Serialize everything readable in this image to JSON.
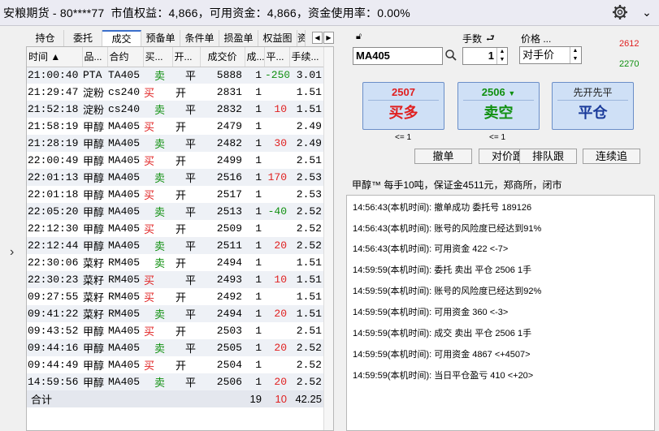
{
  "titlebar": {
    "text": "安粮期货 - 80****77  市值权益：4,866，可用资金：4,866，资金使用率：0.00%"
  },
  "tabs": [
    "持仓",
    "委托",
    "成交",
    "预备单",
    "条件单",
    "损盈单",
    "权益图",
    "资"
  ],
  "active_tab": "成交",
  "trades_table": {
    "columns": [
      "时间 ▲",
      "品...",
      "合约",
      "买...",
      "开...",
      "成交价",
      "成...",
      "平...",
      "手续..."
    ],
    "rows": [
      {
        "time": "21:00:40",
        "product": "PTA",
        "contract": "TA405",
        "dir": "卖",
        "oc": "平",
        "price": "5888",
        "qty": "1",
        "pnl": "-250",
        "fee": "3.01"
      },
      {
        "time": "21:29:47",
        "product": "淀粉",
        "contract": "cs240",
        "dir": "买",
        "oc": "开",
        "price": "2831",
        "qty": "1",
        "pnl": "",
        "fee": "1.51"
      },
      {
        "time": "21:52:18",
        "product": "淀粉",
        "contract": "cs240",
        "dir": "卖",
        "oc": "平",
        "price": "2832",
        "qty": "1",
        "pnl": "10",
        "fee": "1.51"
      },
      {
        "time": "21:58:19",
        "product": "甲醇",
        "contract": "MA405",
        "dir": "买",
        "oc": "开",
        "price": "2479",
        "qty": "1",
        "pnl": "",
        "fee": "2.49"
      },
      {
        "time": "21:28:19",
        "product": "甲醇",
        "contract": "MA405",
        "dir": "卖",
        "oc": "平",
        "price": "2482",
        "qty": "1",
        "pnl": "30",
        "fee": "2.49"
      },
      {
        "time": "22:00:49",
        "product": "甲醇",
        "contract": "MA405",
        "dir": "买",
        "oc": "开",
        "price": "2499",
        "qty": "1",
        "pnl": "",
        "fee": "2.51"
      },
      {
        "time": "22:01:13",
        "product": "甲醇",
        "contract": "MA405",
        "dir": "卖",
        "oc": "平",
        "price": "2516",
        "qty": "1",
        "pnl": "170",
        "fee": "2.53"
      },
      {
        "time": "22:01:18",
        "product": "甲醇",
        "contract": "MA405",
        "dir": "买",
        "oc": "开",
        "price": "2517",
        "qty": "1",
        "pnl": "",
        "fee": "2.53"
      },
      {
        "time": "22:05:20",
        "product": "甲醇",
        "contract": "MA405",
        "dir": "卖",
        "oc": "平",
        "price": "2513",
        "qty": "1",
        "pnl": "-40",
        "fee": "2.52"
      },
      {
        "time": "22:12:30",
        "product": "甲醇",
        "contract": "MA405",
        "dir": "买",
        "oc": "开",
        "price": "2509",
        "qty": "1",
        "pnl": "",
        "fee": "2.52"
      },
      {
        "time": "22:12:44",
        "product": "甲醇",
        "contract": "MA405",
        "dir": "卖",
        "oc": "平",
        "price": "2511",
        "qty": "1",
        "pnl": "20",
        "fee": "2.52"
      },
      {
        "time": "22:30:06",
        "product": "菜籽",
        "contract": "RM405",
        "dir": "卖",
        "oc": "开",
        "price": "2494",
        "qty": "1",
        "pnl": "",
        "fee": "1.51"
      },
      {
        "time": "22:30:23",
        "product": "菜籽",
        "contract": "RM405",
        "dir": "买",
        "oc": "平",
        "price": "2493",
        "qty": "1",
        "pnl": "10",
        "fee": "1.51"
      },
      {
        "time": "09:27:55",
        "product": "菜籽",
        "contract": "RM405",
        "dir": "买",
        "oc": "开",
        "price": "2492",
        "qty": "1",
        "pnl": "",
        "fee": "1.51"
      },
      {
        "time": "09:41:22",
        "product": "菜籽",
        "contract": "RM405",
        "dir": "卖",
        "oc": "平",
        "price": "2494",
        "qty": "1",
        "pnl": "20",
        "fee": "1.51"
      },
      {
        "time": "09:43:52",
        "product": "甲醇",
        "contract": "MA405",
        "dir": "买",
        "oc": "开",
        "price": "2503",
        "qty": "1",
        "pnl": "",
        "fee": "2.51"
      },
      {
        "time": "09:44:16",
        "product": "甲醇",
        "contract": "MA405",
        "dir": "卖",
        "oc": "平",
        "price": "2505",
        "qty": "1",
        "pnl": "20",
        "fee": "2.52"
      },
      {
        "time": "09:44:49",
        "product": "甲醇",
        "contract": "MA405",
        "dir": "买",
        "oc": "开",
        "price": "2504",
        "qty": "1",
        "pnl": "",
        "fee": "2.52"
      },
      {
        "time": "14:59:56",
        "product": "甲醇",
        "contract": "MA405",
        "dir": "卖",
        "oc": "平",
        "price": "2506",
        "qty": "1",
        "pnl": "20",
        "fee": "2.52"
      }
    ],
    "total": {
      "label": "合计",
      "qty": "19",
      "pnl": "10",
      "fee": "42.25"
    }
  },
  "order": {
    "contract_code": "MA405",
    "qty_label": "手数",
    "qty": "1",
    "price_label": "价格 ...",
    "price_type": "对手价",
    "upper_price": "2612",
    "lower_price": "2270",
    "buy_price": "2507",
    "buy_label": "买多",
    "sell_price": "2506",
    "sell_label": "卖空",
    "close_top": "先开先平",
    "close_label": "平仓",
    "buy_avail": "<= 1",
    "sell_avail": "<= 1",
    "actions": [
      "撤单",
      "对价跟",
      "排队跟",
      "连续追"
    ]
  },
  "contract_info": "甲醇™ 每手10吨，保证金4511元，郑商所，闭市",
  "log": [
    "14:56:43(本机时间): 撤单成功  委托号  189126",
    "14:56:43(本机时间): 账号的风险度已经达到91%",
    "14:56:43(本机时间): 可用资金 422  <-7>",
    "14:59:59(本机时间): 委托  卖出  平仓  2506  1手",
    "14:59:59(本机时间): 账号的风险度已经达到92%",
    "14:59:59(本机时间): 可用资金 360  <-3>",
    "14:59:59(本机时间): 成交  卖出  平仓  2506  1手",
    "14:59:59(本机时间): 可用资金 4867  <+4507>",
    "14:59:59(本机时间): 当日平仓盈亏 410  <+20>"
  ],
  "colors": {
    "buy": "#e02020",
    "sell": "#109010",
    "accent": "#3a6ecb"
  }
}
